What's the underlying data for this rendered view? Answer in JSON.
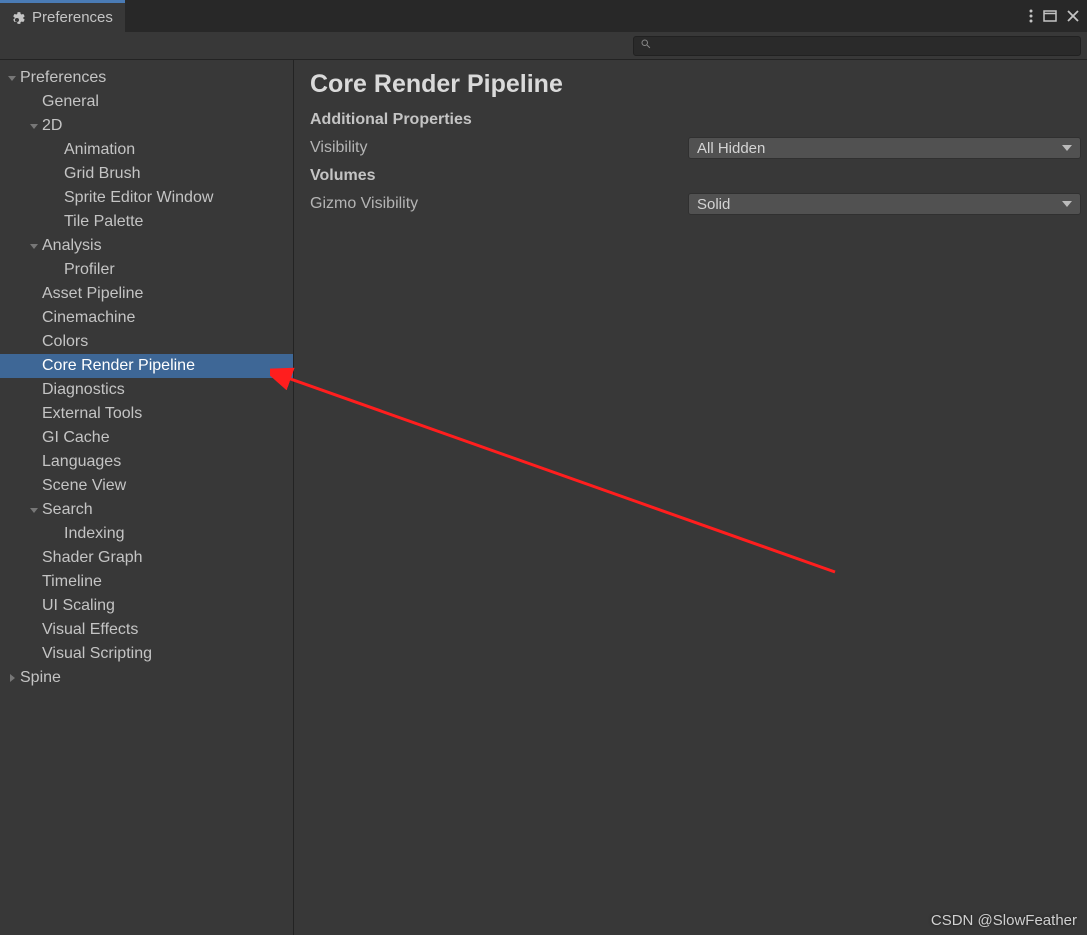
{
  "window": {
    "tab_title": "Preferences"
  },
  "search": {
    "placeholder": ""
  },
  "tree": [
    {
      "label": "Preferences",
      "depth": 0,
      "expander": "down",
      "selected": false
    },
    {
      "label": "General",
      "depth": 1,
      "expander": "none",
      "selected": false
    },
    {
      "label": "2D",
      "depth": 1,
      "expander": "down",
      "selected": false
    },
    {
      "label": "Animation",
      "depth": 2,
      "expander": "none",
      "selected": false
    },
    {
      "label": "Grid Brush",
      "depth": 2,
      "expander": "none",
      "selected": false
    },
    {
      "label": "Sprite Editor Window",
      "depth": 2,
      "expander": "none",
      "selected": false
    },
    {
      "label": "Tile Palette",
      "depth": 2,
      "expander": "none",
      "selected": false
    },
    {
      "label": "Analysis",
      "depth": 1,
      "expander": "down",
      "selected": false
    },
    {
      "label": "Profiler",
      "depth": 2,
      "expander": "none",
      "selected": false
    },
    {
      "label": "Asset Pipeline",
      "depth": 1,
      "expander": "none",
      "selected": false
    },
    {
      "label": "Cinemachine",
      "depth": 1,
      "expander": "none",
      "selected": false
    },
    {
      "label": "Colors",
      "depth": 1,
      "expander": "none",
      "selected": false
    },
    {
      "label": "Core Render Pipeline",
      "depth": 1,
      "expander": "none",
      "selected": true
    },
    {
      "label": "Diagnostics",
      "depth": 1,
      "expander": "none",
      "selected": false
    },
    {
      "label": "External Tools",
      "depth": 1,
      "expander": "none",
      "selected": false
    },
    {
      "label": "GI Cache",
      "depth": 1,
      "expander": "none",
      "selected": false
    },
    {
      "label": "Languages",
      "depth": 1,
      "expander": "none",
      "selected": false
    },
    {
      "label": "Scene View",
      "depth": 1,
      "expander": "none",
      "selected": false
    },
    {
      "label": "Search",
      "depth": 1,
      "expander": "down",
      "selected": false
    },
    {
      "label": "Indexing",
      "depth": 2,
      "expander": "none",
      "selected": false
    },
    {
      "label": "Shader Graph",
      "depth": 1,
      "expander": "none",
      "selected": false
    },
    {
      "label": "Timeline",
      "depth": 1,
      "expander": "none",
      "selected": false
    },
    {
      "label": "UI Scaling",
      "depth": 1,
      "expander": "none",
      "selected": false
    },
    {
      "label": "Visual Effects",
      "depth": 1,
      "expander": "none",
      "selected": false
    },
    {
      "label": "Visual Scripting",
      "depth": 1,
      "expander": "none",
      "selected": false
    },
    {
      "label": "Spine",
      "depth": 0,
      "expander": "right",
      "selected": false
    }
  ],
  "main": {
    "title": "Core Render Pipeline",
    "sections": {
      "additional_properties": "Additional Properties",
      "volumes": "Volumes"
    },
    "visibility_label": "Visibility",
    "visibility_value": "All Hidden",
    "gizmo_label": "Gizmo Visibility",
    "gizmo_value": "Solid"
  },
  "watermark": "CSDN @SlowFeather"
}
